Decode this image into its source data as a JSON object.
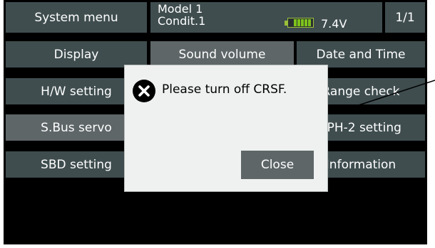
{
  "header": {
    "title": "System menu",
    "model": "Model 1",
    "condition": "Condit.1",
    "voltage": "7.4V",
    "page": "1/1"
  },
  "menu": {
    "display": "Display",
    "sound_volume": "Sound volume",
    "date_time": "Date and Time",
    "hw_setting": "H/W setting",
    "range_check": "Range check",
    "sbus_servo": "S.Bus servo",
    "lph2_setting": "LPH-2 setting",
    "sbd_setting": "SBD setting",
    "information": "Information"
  },
  "dialog": {
    "message": "Please turn off CRSF.",
    "close_label": "Close",
    "icon": "x-circle-icon"
  },
  "colors": {
    "button_bg": "#3f4d4f",
    "selected_bg": "#5e6668",
    "screen_bg": "#000000",
    "dialog_bg": "#eef1ef",
    "battery_green": "#7ec21b"
  }
}
